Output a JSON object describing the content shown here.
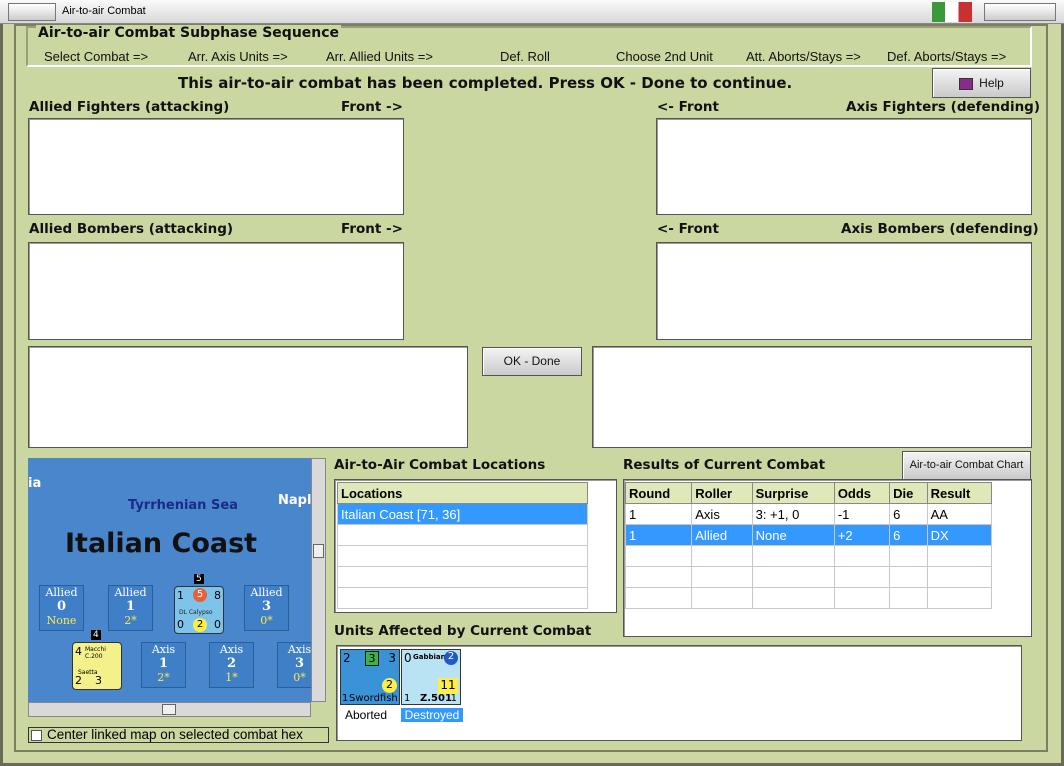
{
  "window": {
    "title": "Air-to-air Combat"
  },
  "sequence": {
    "title": "Air-to-air Combat Subphase Sequence",
    "steps": [
      "Select Combat =>",
      "Arr. Axis Units =>",
      "Arr. Allied Units =>",
      "Def. Roll",
      "Choose 2nd Unit",
      "Att. Aborts/Stays =>",
      "Def. Aborts/Stays =>"
    ]
  },
  "status": "This air-to-air combat has been completed.  Press OK - Done to continue.",
  "help_label": "Help",
  "panels": {
    "allied_fighters": "Allied Fighters (attacking)",
    "front_right_1": "Front ->",
    "axis_fighters": "Axis Fighters (defending)",
    "front_left_1": "<- Front",
    "allied_bombers": "Allied Bombers (attacking)",
    "front_right_2": "Front ->",
    "axis_bombers": "Axis Bombers (defending)",
    "front_left_2": "<- Front"
  },
  "ok_label": "OK - Done",
  "chart_button": "Air-to-air Combat Chart",
  "locations": {
    "title": "Air-to-Air Combat Locations",
    "header": "Locations",
    "items": [
      "Italian Coast [71, 36]"
    ]
  },
  "results": {
    "title": "Results of Current Combat",
    "headers": [
      "Round",
      "Roller",
      "Surprise",
      "Odds",
      "Die",
      "Result"
    ],
    "rows": [
      [
        "1",
        "Axis",
        "3: +1, 0",
        "-1",
        "6",
        "AA"
      ],
      [
        "1",
        "Allied",
        "None",
        "+2",
        "6",
        "DX"
      ]
    ]
  },
  "affected": {
    "title": "Units Affected by Current Combat",
    "units": [
      {
        "name": "Swordfish",
        "status": "Aborted",
        "tl": "2",
        "tc": "3",
        "tr": "3",
        "bl": "1",
        "br": "2",
        "color": "#3a93d6"
      },
      {
        "name": "Z.501",
        "top_name": "Gabbiano",
        "status": "Destroyed",
        "tl": "0",
        "tr": "2",
        "br": "11",
        "bl": "1",
        "bl2": "1",
        "color": "#b9e2f3"
      }
    ]
  },
  "map": {
    "sea": "Tyrrhenian Sea",
    "region": "Italian Coast",
    "partial_left": "ia",
    "partial_right": "Napl",
    "hexes": [
      {
        "side": "Allied",
        "n": "0",
        "y": "None"
      },
      {
        "side": "Allied",
        "n": "1",
        "y": "2*"
      },
      {
        "side": "Allied",
        "n": "3",
        "y": "0*"
      },
      {
        "side": "Axis",
        "n": "1",
        "y": "2*"
      },
      {
        "side": "Axis",
        "n": "2",
        "y": "1*"
      },
      {
        "side": "Axis",
        "n": "3",
        "y": "0*"
      }
    ],
    "calypso": {
      "name": "DL Calypso",
      "tl": "1",
      "tc": "5",
      "tr": "8",
      "bl": "0",
      "bc": "2",
      "br": "0",
      "stack": "5"
    },
    "macchi": {
      "name": "Macchi C.200",
      "sub": "Saetta",
      "tl": "4",
      "bl": "2",
      "br": "3",
      "stack": "4"
    }
  },
  "center_map_label": "Center linked map on selected combat hex"
}
